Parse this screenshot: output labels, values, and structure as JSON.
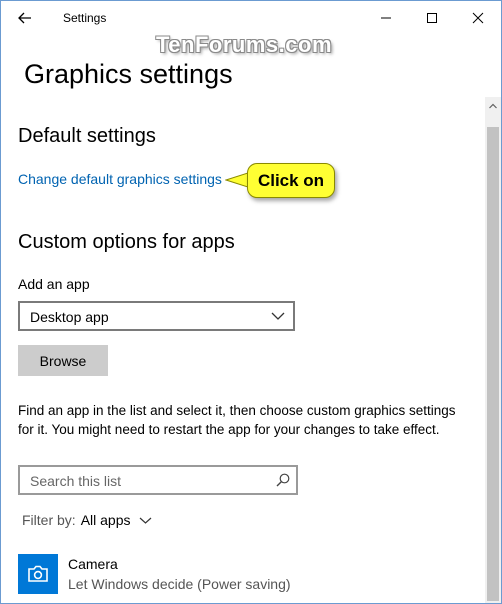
{
  "window": {
    "title": "Settings",
    "watermark": "TenForums.com"
  },
  "page": {
    "title": "Graphics settings"
  },
  "default_settings": {
    "heading": "Default settings",
    "link": "Change default graphics settings",
    "callout": "Click on"
  },
  "custom_options": {
    "heading": "Custom options for apps",
    "add_app_label": "Add an app",
    "app_type_selected": "Desktop app",
    "browse_label": "Browse",
    "description": "Find an app in the list and select it, then choose custom graphics settings for it. You might need to restart the app for your changes to take effect.",
    "search_placeholder": "Search this list",
    "filter_label": "Filter by:",
    "filter_value": "All apps"
  },
  "apps": [
    {
      "name": "Camera",
      "setting": "Let Windows decide (Power saving)",
      "icon": "camera-icon"
    }
  ],
  "colors": {
    "accent": "#0078d7",
    "link": "#0063b1",
    "callout": "#ffff33"
  }
}
